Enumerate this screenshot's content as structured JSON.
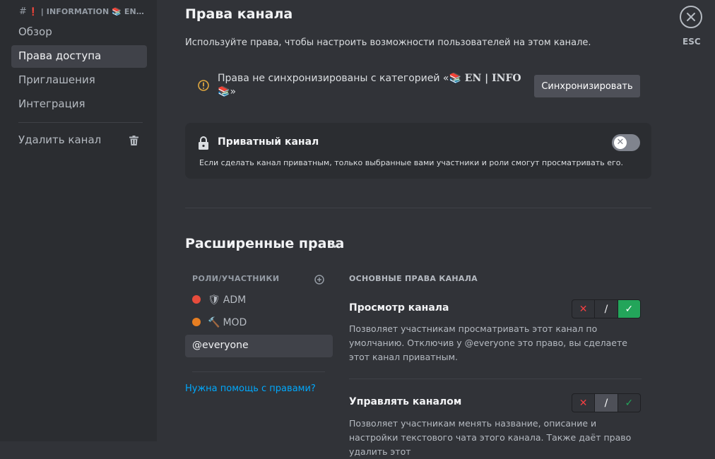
{
  "sidebar": {
    "category": {
      "hash": "#",
      "mark": "❗",
      "name": "| INFORMATION 📚 EN…"
    },
    "items": [
      {
        "label": "Обзор"
      },
      {
        "label": "Права доступа"
      },
      {
        "label": "Приглашения"
      },
      {
        "label": "Интеграция"
      }
    ],
    "delete_label": "Удалить канал"
  },
  "header": {
    "title": "Права канала",
    "description": "Используйте права, чтобы настроить возможности пользователей на этом канале."
  },
  "sync": {
    "text_prefix": "Права не синхронизированы с категорией «",
    "category": "📚 𝐄𝐍 | 𝐈𝐍𝐅𝐎 📚",
    "text_suffix": "»",
    "button": "Синхронизировать"
  },
  "private_channel": {
    "title": "Приватный канал",
    "description": "Если сделать канал приватным, только выбранные вами участники и роли смогут просматривать его.",
    "enabled": false
  },
  "advanced": {
    "title": "Расширенные права",
    "roles_header": "РОЛИ/УЧАСТНИКИ",
    "roles": [
      {
        "icon": "🛡",
        "name": "ADM",
        "color": "#e74c3c"
      },
      {
        "icon": "🔨",
        "name": "MOD",
        "color": "#e67e22"
      },
      {
        "name": "@everyone"
      }
    ],
    "help_link": "Нужна помощь с правами?",
    "perm_header": "ОСНОВНЫЕ ПРАВА КАНАЛА",
    "permissions": [
      {
        "name": "Просмотр канала",
        "description": "Позволяет участникам просматривать этот канал по умолчанию. Отключив у @everyone это право, вы сделаете этот канал приватным.",
        "state": "allow"
      },
      {
        "name": "Управлять каналом",
        "description": "Позволяет участникам менять название, описание и настройки текстового чата этого канала. Также даёт право удалить этот",
        "state": "neutral"
      }
    ],
    "toggle_symbols": {
      "deny": "✕",
      "neutral": "/",
      "allow": "✓"
    }
  },
  "close": {
    "label": "ESC"
  },
  "colors": {
    "allow": "#23a55a",
    "deny": "#f23f42",
    "link": "#00a8fc",
    "selected_bg": "#404249"
  }
}
